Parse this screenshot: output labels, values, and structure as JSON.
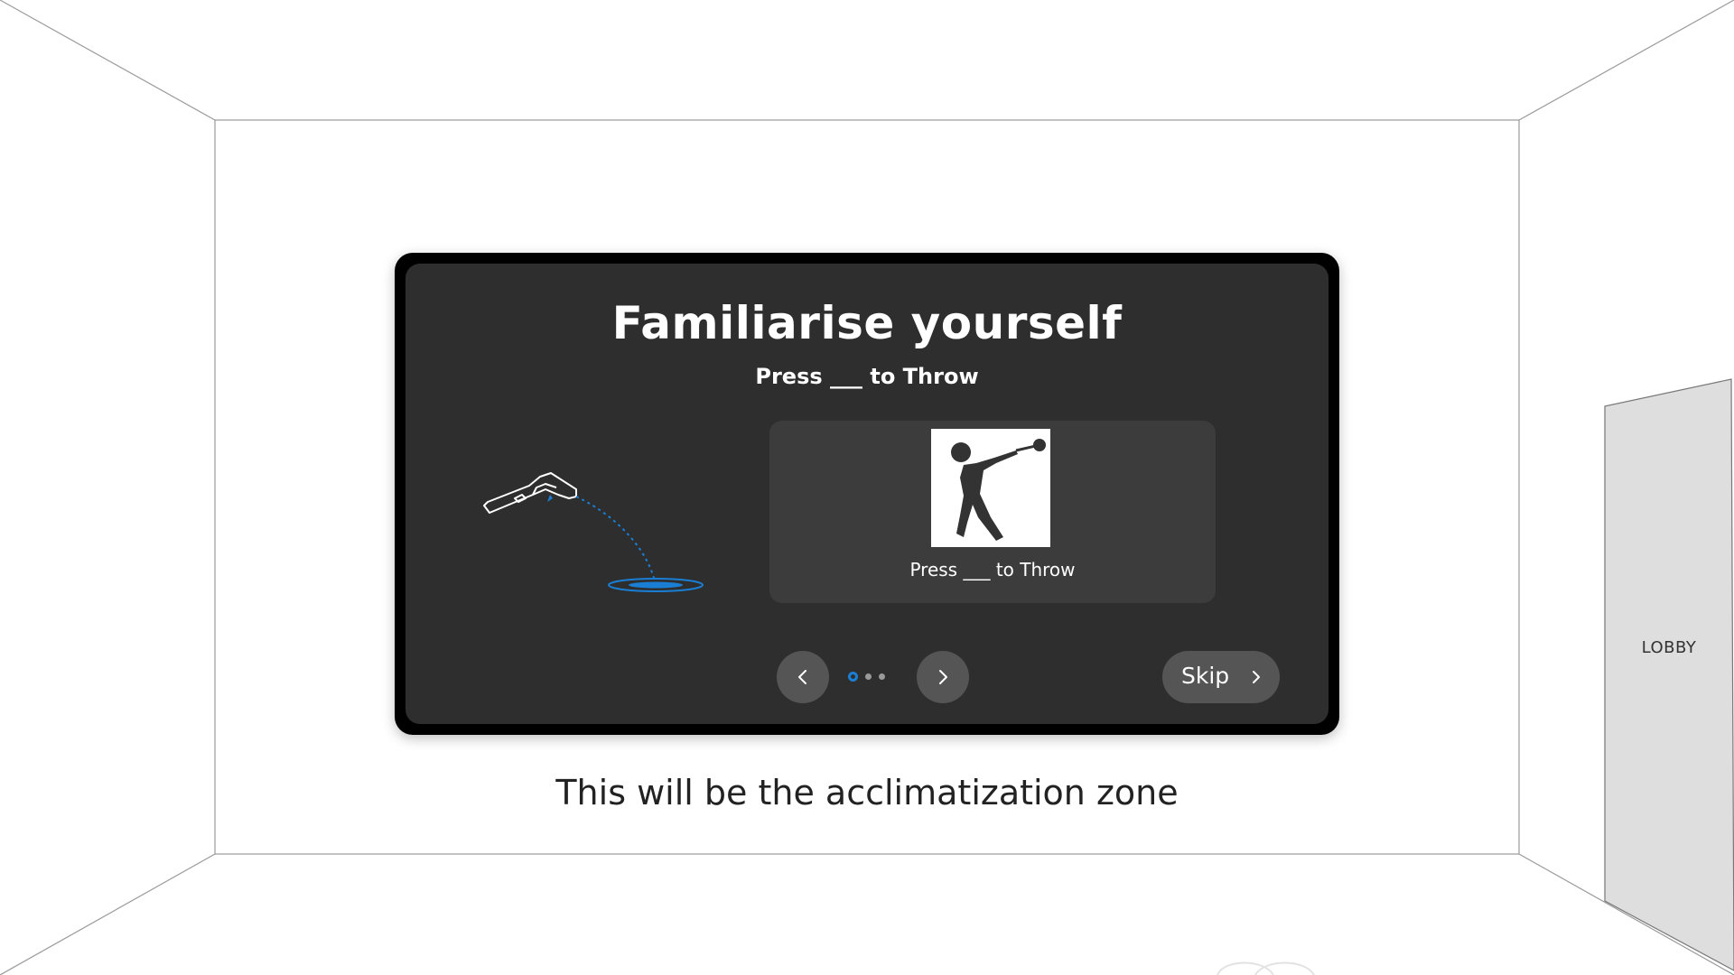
{
  "dialog": {
    "title": "Familiarise yourself",
    "subtitle": "Press ___ to Throw",
    "media_caption": "Press ___ to Throw",
    "media_icon": "hammer-throw-pictogram",
    "pagination": {
      "current": 1,
      "total": 3
    },
    "skip_label": "Skip",
    "prev_icon": "chevron-left-icon",
    "next_icon": "chevron-right-icon"
  },
  "scene": {
    "zone_text": "This will be the acclimatization zone",
    "door_label": "LOBBY"
  },
  "colors": {
    "panel": "#2e2e2e",
    "panel_border": "#000000",
    "media_card": "#3c3c3c",
    "button": "#555555",
    "accent": "#1a7fd4",
    "door": "#dedede"
  }
}
